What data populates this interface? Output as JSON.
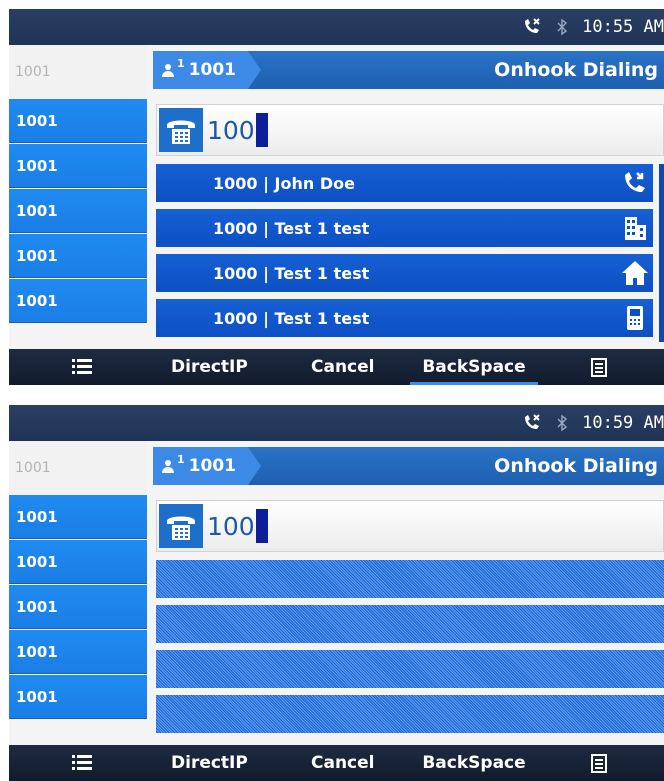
{
  "screens": [
    {
      "status": {
        "clock": "10:55 AM",
        "icons": [
          "call-forward-icon",
          "bluetooth-icon"
        ]
      },
      "line_panel": {
        "header": "1001",
        "keys": [
          "1001",
          "1001",
          "1001",
          "1001",
          "1001"
        ]
      },
      "title_bar": {
        "account": "1001",
        "account_index": "1",
        "title": "Onhook Dialing"
      },
      "dial_field": {
        "value": "100",
        "icon": "phone-keypad-icon"
      },
      "results": [
        {
          "prefix": "1000",
          "name": " | John Doe",
          "icon": "call-forward-icon"
        },
        {
          "prefix": "1000",
          "name": " | Test 1 test",
          "icon": "office-building-icon"
        },
        {
          "prefix": "1000",
          "name": " | Test 1 test",
          "icon": "home-icon"
        },
        {
          "prefix": "1000",
          "name": " | Test 1 test",
          "icon": "mobile-phone-icon"
        }
      ],
      "softkeys": {
        "menu_icon": "list-menu-icon",
        "items": [
          "DirectIP",
          "Cancel",
          "BackSpace"
        ],
        "active": "BackSpace",
        "more_icon": "more-icon"
      }
    },
    {
      "status": {
        "clock": "10:59 AM",
        "icons": [
          "call-forward-icon",
          "bluetooth-icon"
        ]
      },
      "line_panel": {
        "header": "1001",
        "keys": [
          "1001",
          "1001",
          "1001",
          "1001",
          "1001"
        ]
      },
      "title_bar": {
        "account": "1001",
        "account_index": "1",
        "title": "Onhook Dialing"
      },
      "dial_field": {
        "value": "100",
        "icon": "phone-keypad-icon"
      },
      "results_state": "loading",
      "softkeys": {
        "menu_icon": "list-menu-icon",
        "items": [
          "DirectIP",
          "Cancel",
          "BackSpace"
        ],
        "more_icon": "more-icon"
      }
    }
  ],
  "colors": {
    "statusbar": "#1f3356",
    "line_key": "#1a7ee6",
    "title_bar": "#1e5fb0",
    "result_row": "#0d4fc4",
    "softkey_bar": "#121b2d",
    "caret": "#0c1f99"
  }
}
